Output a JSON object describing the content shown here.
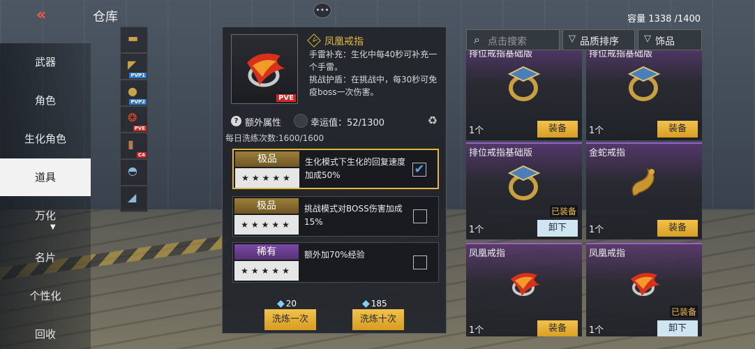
{
  "header": {
    "back_icon": "double-chevron-left-icon",
    "title": "仓库",
    "chat_icon": "chat-bubble-icon",
    "capacity": "容量 1338 /1400"
  },
  "nav": {
    "items": [
      {
        "label": "武器"
      },
      {
        "label": "角色"
      },
      {
        "label": "生化角色"
      },
      {
        "label": "道具",
        "active": true
      },
      {
        "label": "万化"
      },
      {
        "label": "名片"
      },
      {
        "label": "个性化"
      },
      {
        "label": "回收"
      }
    ]
  },
  "thumbs": [
    {
      "icon": "rifle-icon",
      "tag": ""
    },
    {
      "icon": "pistol-icon",
      "tag": "PVP1"
    },
    {
      "icon": "grenade-icon",
      "tag": "PVP2"
    },
    {
      "icon": "phoenix-ring-icon",
      "tag": "PVE"
    },
    {
      "icon": "c4-icon",
      "tag": "C4"
    },
    {
      "icon": "helmet-icon",
      "tag": ""
    },
    {
      "icon": "knife-icon",
      "tag": ""
    }
  ],
  "detail": {
    "item_tag": "PVE",
    "name": "凤凰戒指",
    "desc_line1": "手雷补充：生化中每40秒可补充一个手雷。",
    "desc_line2": "挑战护盾：在挑战中，每30秒可免疫boss一次伤害。",
    "attr_label": "额外属性",
    "luck": "幸运值：52/1300",
    "daily": "每日洗练次数:1600/1600",
    "options": [
      {
        "grade": "极品",
        "stars": "★★★★★",
        "text": "生化模式下生化的回复速度加成50%",
        "checked": "✔",
        "selected": true
      },
      {
        "grade": "极品",
        "stars": "★★★★★",
        "text": "挑战模式对BOSS伤害加成15%",
        "checked": ""
      },
      {
        "grade": "稀有",
        "stars": "★★★★★",
        "text": "额外加70%经验",
        "checked": ""
      }
    ],
    "cost_once": "20",
    "cost_ten": "185",
    "btn_once": "洗炼一次",
    "btn_ten": "洗炼十次"
  },
  "toolbar": {
    "search_placeholder": "点击搜索",
    "sort_label": "品质排序",
    "filter_label": "饰品"
  },
  "cards": [
    {
      "name": "排位戒指基础版",
      "qty": "1个",
      "btn": "装备",
      "equipped": ""
    },
    {
      "name": "排位戒指基础版",
      "qty": "1个",
      "btn": "装备",
      "equipped": ""
    },
    {
      "name": "排位戒指基础版",
      "qty": "1个",
      "btn": "卸下",
      "equipped": "已装备"
    },
    {
      "name": "金蛇戒指",
      "qty": "1个",
      "btn": "装备",
      "equipped": ""
    },
    {
      "name": "凤凰戒指",
      "qty": "1个",
      "btn": "装备",
      "equipped": ""
    },
    {
      "name": "凤凰戒指",
      "qty": "1个",
      "btn": "卸下",
      "equipped": "已装备"
    }
  ],
  "colors": {
    "accent_gold": "#e0b93b",
    "button_gold": "#f2c24d",
    "unequip_blue": "#cfe5f2",
    "purple_rare": "#7a4aa6",
    "pve_red": "#d52626"
  }
}
